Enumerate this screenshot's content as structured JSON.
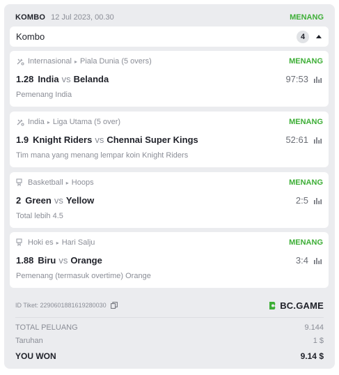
{
  "header": {
    "type": "KOMBO",
    "date": "12 Jul 2023, 00.30",
    "status": "MENANG"
  },
  "combo": {
    "title": "Kombo",
    "count": "4"
  },
  "bets": [
    {
      "sport_icon": "cricket-icon",
      "sport": "Internasional",
      "league": "Piala Dunia (5 overs)",
      "status": "MENANG",
      "odds": "1.28",
      "home": "India",
      "vs": "vs",
      "away": "Belanda",
      "score": "97:53",
      "pick": "Pemenang India"
    },
    {
      "sport_icon": "cricket-icon",
      "sport": "India",
      "league": "Liga Utama (5 over)",
      "status": "MENANG",
      "odds": "1.9",
      "home": "Knight Riders",
      "vs": "vs",
      "away": "Chennai Super Kings",
      "score": "52:61",
      "pick": "Tim mana yang menang lempar koin Knight Riders"
    },
    {
      "sport_icon": "basketball-icon",
      "sport": "Basketball",
      "league": "Hoops",
      "status": "MENANG",
      "odds": "2",
      "home": "Green",
      "vs": "vs",
      "away": "Yellow",
      "score": "2:5",
      "pick": "Total lebih 4.5"
    },
    {
      "sport_icon": "hockey-icon",
      "sport": "Hoki es",
      "league": "Hari Salju",
      "status": "MENANG",
      "odds": "1.88",
      "home": "Biru",
      "vs": "vs",
      "away": "Orange",
      "score": "3:4",
      "pick": "Pemenang (termasuk overtime) Orange"
    }
  ],
  "ticket": {
    "id": "ID Tiket: 2290601881619280030",
    "brand": "BC.GAME"
  },
  "summary": {
    "total_odds_label": "TOTAL PELUANG",
    "total_odds": "9.144",
    "stake_label": "Taruhan",
    "stake": "1 $",
    "won_label": "YOU WON",
    "won": "9.14 $"
  },
  "colors": {
    "win": "#3dae36",
    "card_bg": "#ebecef",
    "brand": "#3dae36"
  }
}
